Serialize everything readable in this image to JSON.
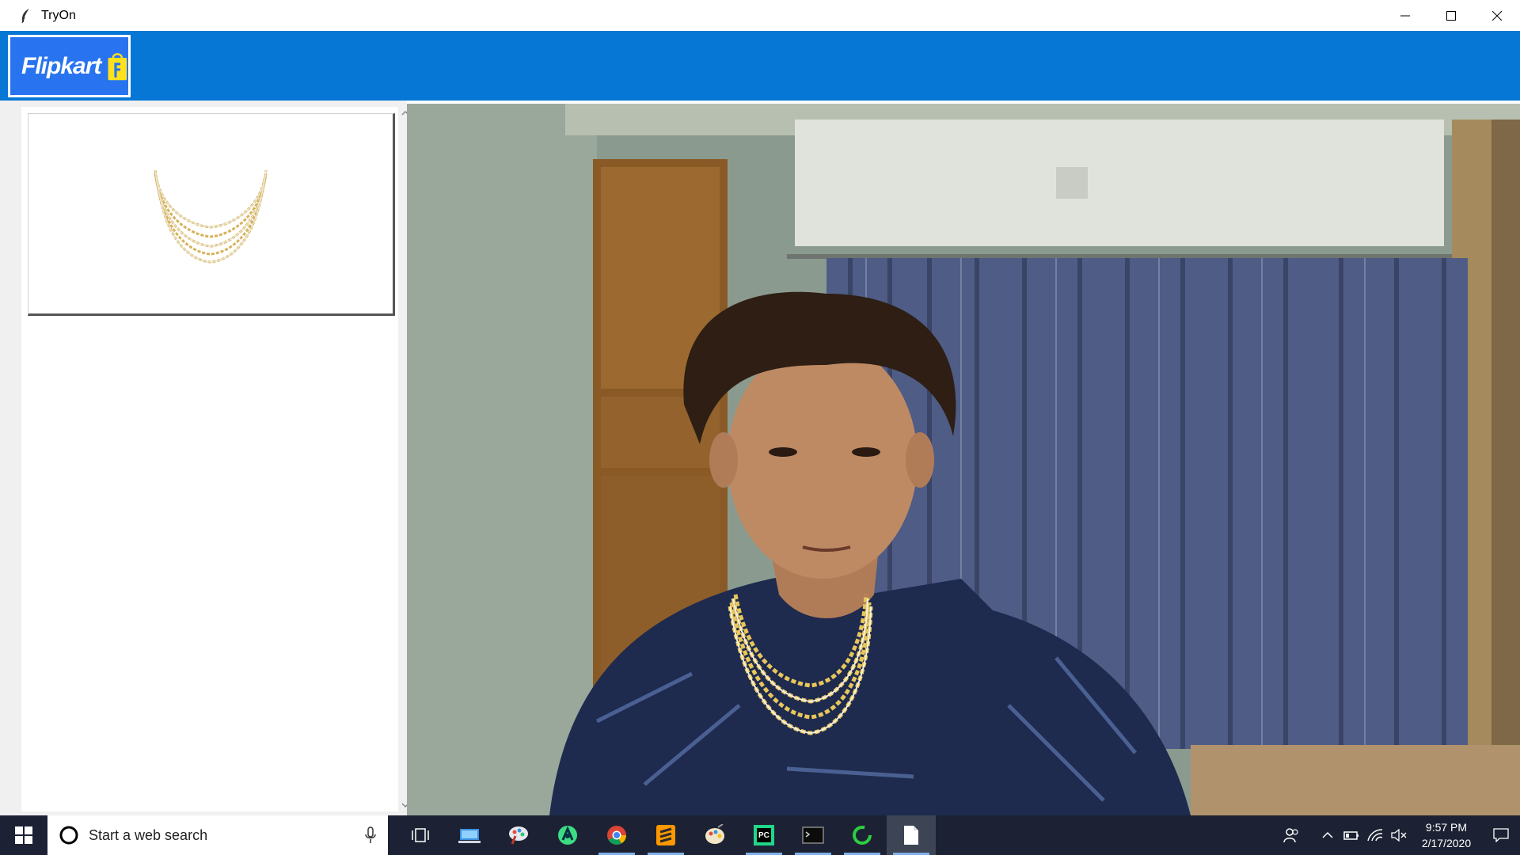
{
  "window": {
    "title": "TryOn"
  },
  "header": {
    "logo_text": "Flipkart",
    "brand_color": "#0677D4",
    "logo_bg": "#2874F0",
    "bag_color": "#FFE11B"
  },
  "sidebar": {
    "products": [
      {
        "name": "necklace-thumbnail"
      }
    ]
  },
  "taskbar": {
    "search_placeholder": "Start a web search",
    "time": "9:57 PM",
    "date": "2/17/2020",
    "apps": [
      {
        "icon": "task-view-icon"
      },
      {
        "icon": "file-explorer-icon"
      },
      {
        "icon": "paint-3d-icon"
      },
      {
        "icon": "android-studio-icon"
      },
      {
        "icon": "chrome-icon",
        "active": true
      },
      {
        "icon": "sublime-text-icon",
        "active": true
      },
      {
        "icon": "paint-icon"
      },
      {
        "icon": "pycharm-icon",
        "active": true
      },
      {
        "icon": "terminal-icon",
        "active": true
      },
      {
        "icon": "cursor-loader-icon",
        "active": true
      },
      {
        "icon": "document-icon",
        "active": true,
        "selected": true
      }
    ]
  }
}
